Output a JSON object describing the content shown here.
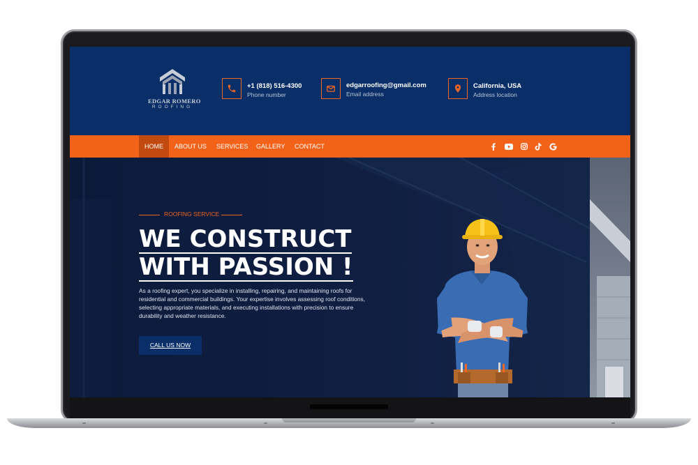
{
  "brand": {
    "name": "EDGAR ROMERO",
    "tagline": "ROOFING"
  },
  "contacts": [
    {
      "icon": "phone-icon",
      "value": "+1 (818) 516-4300",
      "label": "Phone number"
    },
    {
      "icon": "email-icon",
      "value": "edgarroofing@gmail.com",
      "label": "Email address"
    },
    {
      "icon": "location-pin-icon",
      "value": "California, USA",
      "label": "Address location"
    }
  ],
  "nav": {
    "items": [
      "HOME",
      "ABOUT US",
      "SERVICES",
      "GALLERY",
      "CONTACT"
    ],
    "active": "HOME"
  },
  "social": [
    "facebook-icon",
    "youtube-icon",
    "instagram-icon",
    "tiktok-icon",
    "google-icon"
  ],
  "hero": {
    "tag": "ROOFING SERVICE",
    "headline_line1": "WE CONSTRUCT",
    "headline_line2": "WITH PASSION !",
    "body": "As a roofing expert, you specialize in installing, repairing, and maintaining roofs for residential and commercial buildings. Your expertise involves assessing roof conditions, selecting appropriate materials, and executing installations with precision to ensure durability and weather resistance.",
    "cta": "CALL US NOW"
  },
  "colors": {
    "header_navy": "#0a2f68",
    "accent_orange": "#f26218",
    "hero_bg": "#0c1a3a"
  }
}
